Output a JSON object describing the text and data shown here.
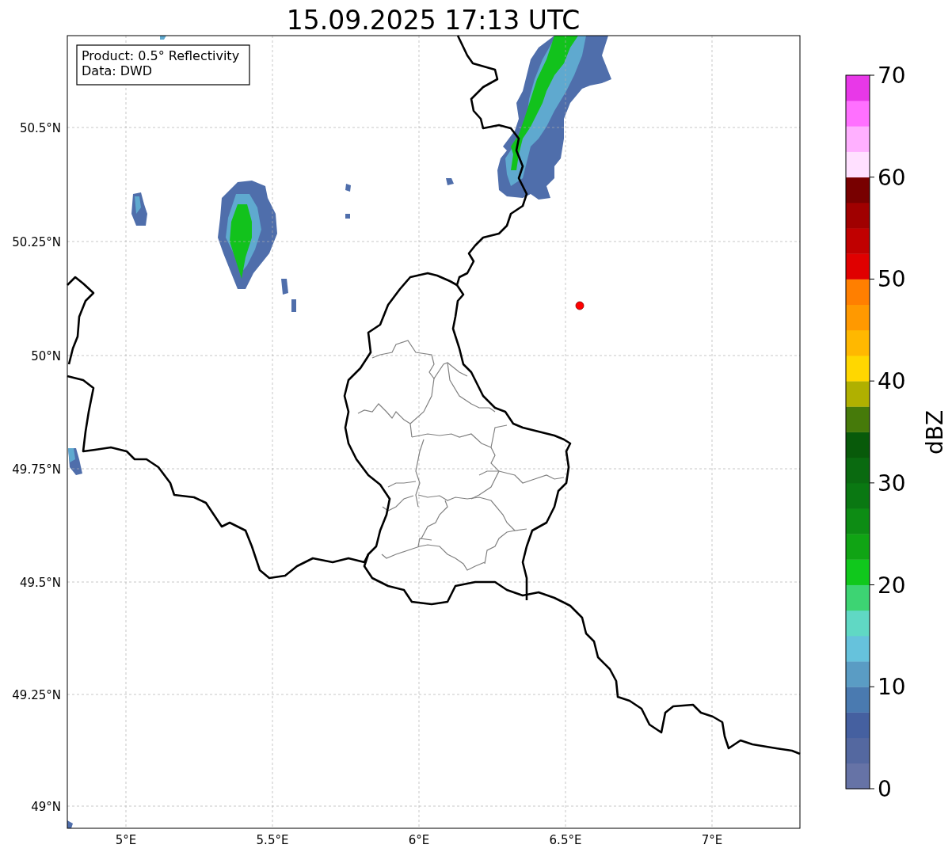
{
  "title": "15.09.2025 17:13 UTC",
  "map": {
    "info_box": [
      "Product: 0.5° Reflectivity",
      "Data: DWD"
    ],
    "y_tick_labels": [
      "50.5°N",
      "50.25°N",
      "50°N",
      "49.75°N",
      "49.5°N",
      "49.25°N",
      "49°N"
    ],
    "x_tick_labels": [
      "5°E",
      "5.5°E",
      "6°E",
      "6.5°E",
      "7°E"
    ]
  },
  "colorbar": {
    "label": "dBZ",
    "ticks": [
      "70",
      "60",
      "50",
      "40",
      "30",
      "20",
      "10",
      "0"
    ],
    "segments": [
      {
        "color": "#6673a6"
      },
      {
        "color": "#5468a0"
      },
      {
        "color": "#4560a0"
      },
      {
        "color": "#4a7ab0"
      },
      {
        "color": "#5a9cc4"
      },
      {
        "color": "#66c2dc"
      },
      {
        "color": "#60d8c4"
      },
      {
        "color": "#3dd473"
      },
      {
        "color": "#10c81c"
      },
      {
        "color": "#10a414"
      },
      {
        "color": "#0d8c14"
      },
      {
        "color": "#0a7812"
      },
      {
        "color": "#0a6a10"
      },
      {
        "color": "#085a0a"
      },
      {
        "color": "#467a0a"
      },
      {
        "color": "#b0b000"
      },
      {
        "color": "#ffd700"
      },
      {
        "color": "#ffb800"
      },
      {
        "color": "#ff9900"
      },
      {
        "color": "#ff7f00"
      },
      {
        "color": "#e00000"
      },
      {
        "color": "#c00000"
      },
      {
        "color": "#a00000"
      },
      {
        "color": "#780000"
      },
      {
        "color": "#ffe0ff"
      },
      {
        "color": "#ffb0ff"
      },
      {
        "color": "#ff70ff"
      },
      {
        "color": "#e838e8"
      }
    ]
  }
}
